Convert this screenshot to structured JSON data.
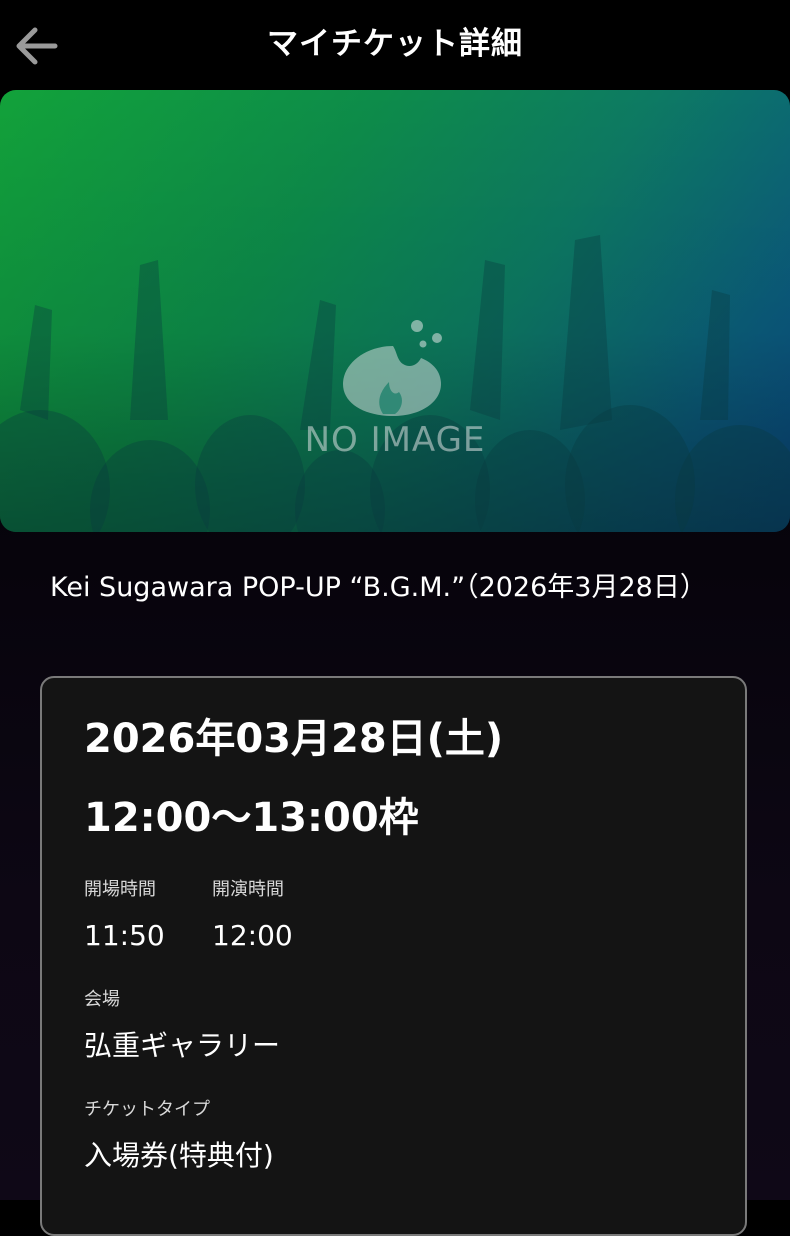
{
  "header": {
    "title": "マイチケット詳細",
    "back_icon": "arrow-left-icon"
  },
  "hero": {
    "placeholder_text": "NO IMAGE",
    "logo_icon": "flame-logo-icon",
    "colors": {
      "green": "#12a23a",
      "blue": "#0a4c86"
    }
  },
  "event": {
    "title": "Kei Sugawara POP-UP “B.G.M.”（2026年3月28日）"
  },
  "ticket": {
    "date": "2026年03月28日(土)",
    "time_slot": "12:00〜13:00枠",
    "open_label": "開場時間",
    "open_value": "11:50",
    "start_label": "開演時間",
    "start_value": "12:00",
    "venue_label": "会場",
    "venue_value": "弘重ギャラリー",
    "type_label": "チケットタイプ",
    "type_value": "入場券(特典付)"
  }
}
